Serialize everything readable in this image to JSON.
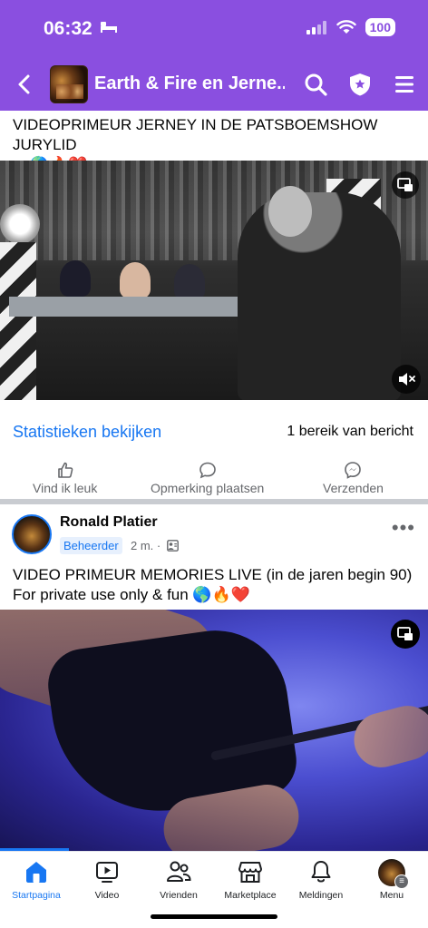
{
  "status_bar": {
    "time": "06:32",
    "battery": "100"
  },
  "header": {
    "title": "Earth & Fire en Jerne..."
  },
  "post1": {
    "text_line1": "VIDEOPRIMEUR JERNEY IN DE PATSBOEMSHOW JURYLID",
    "text_line2": "... 🌎🔥❤️",
    "stats_link": "Statistieken bekijken",
    "reach": "1 bereik van bericht"
  },
  "actions": {
    "like": "Vind ik leuk",
    "comment": "Opmerking plaatsen",
    "send": "Verzenden"
  },
  "post2": {
    "author": "Ronald Platier",
    "role": "Beheerder",
    "time": "2 m. ·",
    "more": "•••",
    "text_line1": "VIDEO PRIMEUR MEMORIES LIVE (in de jaren begin 90)",
    "text_line2": "For private use only & fun 🌎🔥❤️"
  },
  "tabs": [
    {
      "label": "Startpagina",
      "icon": "home-icon",
      "active": true
    },
    {
      "label": "Video",
      "icon": "video-icon",
      "active": false
    },
    {
      "label": "Vrienden",
      "icon": "friends-icon",
      "active": false
    },
    {
      "label": "Marketplace",
      "icon": "marketplace-icon",
      "active": false
    },
    {
      "label": "Meldingen",
      "icon": "bell-icon",
      "active": false
    },
    {
      "label": "Menu",
      "icon": "menu-avatar",
      "active": false
    }
  ],
  "colors": {
    "brand": "#8a4fe0",
    "link": "#1877f2",
    "muted": "#65676b"
  }
}
